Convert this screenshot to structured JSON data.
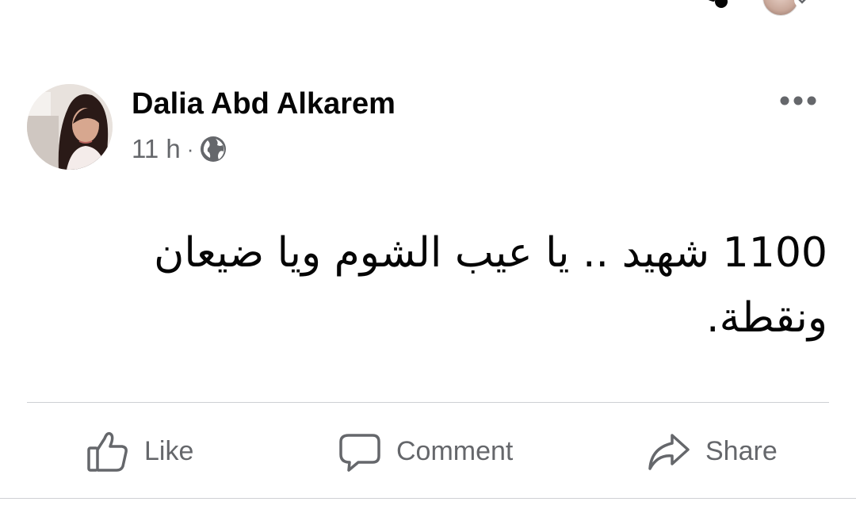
{
  "post": {
    "author": "Dalia Abd Alkarem",
    "time": "11 h",
    "separator": "·",
    "audience_icon": "globe-icon",
    "text_line_1": "1100 شهيد .. يا عيب الشوم ويا ضيعان",
    "text_line_2": "ونقطة."
  },
  "actions": {
    "like_label": "Like",
    "comment_label": "Comment",
    "share_label": "Share"
  },
  "icons": {
    "more": "more-options-icon",
    "like": "thumbs-up-icon",
    "comment": "speech-bubble-icon",
    "share": "share-arrow-icon"
  },
  "colors": {
    "text_primary": "#050505",
    "text_secondary": "#65676b",
    "divider": "#ced0d4"
  }
}
